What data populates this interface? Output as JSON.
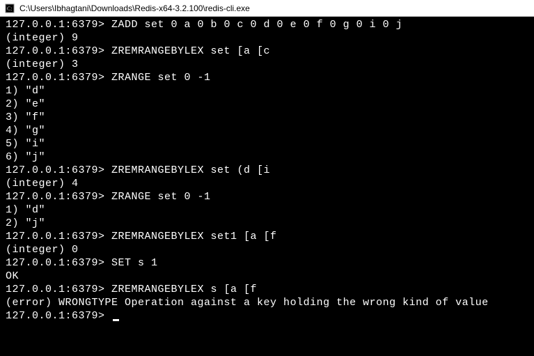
{
  "window": {
    "title": "C:\\Users\\Ibhagtani\\Downloads\\Redis-x64-3.2.100\\redis-cli.exe"
  },
  "prompt": "127.0.0.1:6379>",
  "lines": [
    {
      "type": "cmd",
      "text": "ZADD set 0 a 0 b 0 c 0 d 0 e 0 f 0 g 0 i 0 j"
    },
    {
      "type": "out",
      "text": "(integer) 9"
    },
    {
      "type": "cmd",
      "text": "ZREMRANGEBYLEX set [a [c"
    },
    {
      "type": "out",
      "text": "(integer) 3"
    },
    {
      "type": "cmd",
      "text": "ZRANGE set 0 -1"
    },
    {
      "type": "out",
      "text": "1) \"d\""
    },
    {
      "type": "out",
      "text": "2) \"e\""
    },
    {
      "type": "out",
      "text": "3) \"f\""
    },
    {
      "type": "out",
      "text": "4) \"g\""
    },
    {
      "type": "out",
      "text": "5) \"i\""
    },
    {
      "type": "out",
      "text": "6) \"j\""
    },
    {
      "type": "cmd",
      "text": "ZREMRANGEBYLEX set (d [i"
    },
    {
      "type": "out",
      "text": "(integer) 4"
    },
    {
      "type": "cmd",
      "text": "ZRANGE set 0 -1"
    },
    {
      "type": "out",
      "text": "1) \"d\""
    },
    {
      "type": "out",
      "text": "2) \"j\""
    },
    {
      "type": "cmd",
      "text": "ZREMRANGEBYLEX set1 [a [f"
    },
    {
      "type": "out",
      "text": "(integer) 0"
    },
    {
      "type": "cmd",
      "text": "SET s 1"
    },
    {
      "type": "out",
      "text": "OK"
    },
    {
      "type": "cmd",
      "text": "ZREMRANGEBYLEX s [a [f"
    },
    {
      "type": "out",
      "text": "(error) WRONGTYPE Operation against a key holding the wrong kind of value"
    },
    {
      "type": "prompt",
      "text": ""
    }
  ]
}
